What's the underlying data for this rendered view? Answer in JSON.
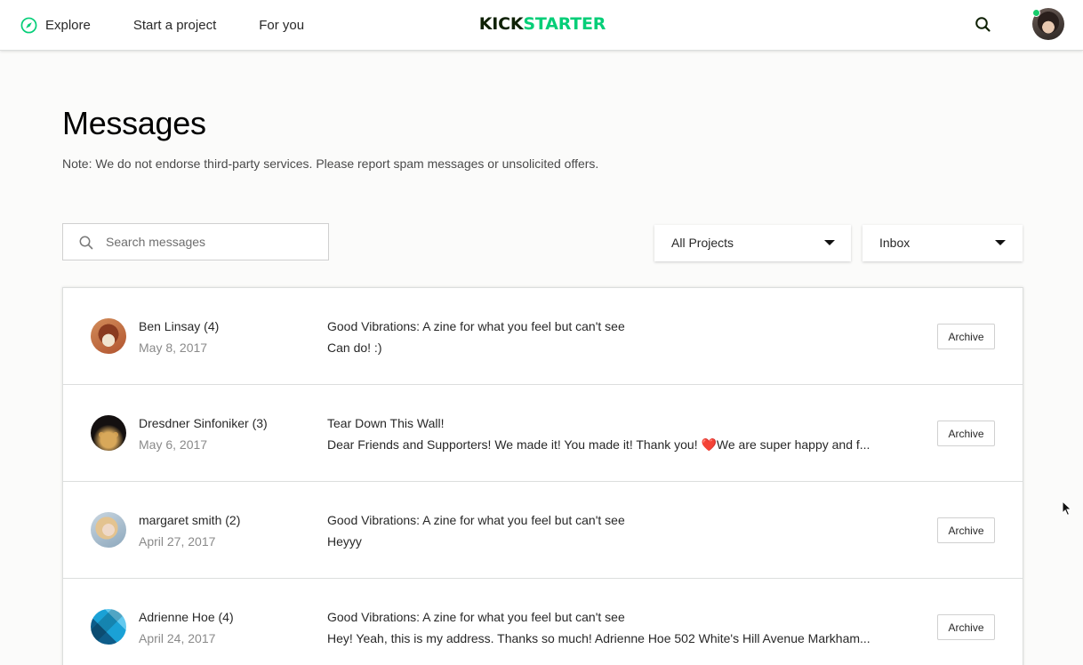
{
  "nav": {
    "explore": "Explore",
    "start_project": "Start a project",
    "for_you": "For you",
    "logo_kick": "KICK",
    "logo_starter": "STARTER",
    "accent": "#05ce78",
    "online_status_color": "#17cc6b"
  },
  "header": {
    "title": "Messages",
    "note": "Note: We do not endorse third-party services. Please report spam messages or unsolicited offers."
  },
  "toolbar": {
    "search_placeholder": "Search messages",
    "projects_filter": "All Projects",
    "folder_filter": "Inbox"
  },
  "messages": [
    {
      "sender": "Ben Linsay (4)",
      "date": "May 8, 2017",
      "subject": "Good Vibrations: A zine for what you feel but can't see",
      "preview": "Can do! :)",
      "archive_label": "Archive"
    },
    {
      "sender": "Dresdner Sinfoniker (3)",
      "date": "May 6, 2017",
      "subject": "Tear Down This Wall!",
      "preview": "Dear Friends and Supporters! We made it! You made it! Thank you! ❤️We are super happy and f...",
      "archive_label": "Archive"
    },
    {
      "sender": "margaret smith (2)",
      "date": "April 27, 2017",
      "subject": "Good Vibrations: A zine for what you feel but can't see",
      "preview": "Heyyy",
      "archive_label": "Archive"
    },
    {
      "sender": "Adrienne Hoe (4)",
      "date": "April 24, 2017",
      "subject": "Good Vibrations: A zine for what you feel but can't see",
      "preview": "Hey! Yeah, this is my address. Thanks so much! Adrienne Hoe 502 White's Hill Avenue Markham...",
      "archive_label": "Archive"
    }
  ]
}
